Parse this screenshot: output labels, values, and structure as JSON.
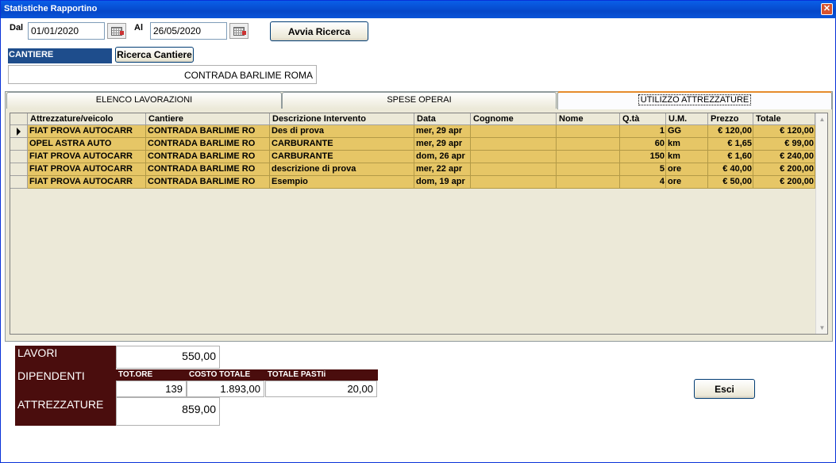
{
  "window": {
    "title": "Statistiche Rapportino",
    "close_glyph": "✕"
  },
  "filters": {
    "dal_label": "Dal",
    "dal_value": "01/01/2020",
    "al_label": "Al",
    "al_value": "26/05/2020",
    "search_button": "Avvia Ricerca"
  },
  "cantiere": {
    "label": "CANTIERE",
    "search_button": "Ricerca Cantiere",
    "value": "CONTRADA BARLIME ROMA"
  },
  "tabs": [
    {
      "label": "ELENCO LAVORAZIONI",
      "active": false
    },
    {
      "label": "SPESE OPERAI",
      "active": false
    },
    {
      "label": "UTILIZZO ATTREZZATURE",
      "active": true
    }
  ],
  "grid": {
    "columns": [
      "Attrezzature/veicolo",
      "Cantiere",
      "Descrizione Intervento",
      "Data",
      "Cognome",
      "Nome",
      "Q.tà",
      "U.M.",
      "Prezzo",
      "Totale"
    ],
    "rows": [
      [
        "FIAT PROVA AUTOCARR",
        "CONTRADA BARLIME RO",
        "Des di prova",
        "mer, 29 apr",
        "",
        "",
        "1",
        "GG",
        "€ 120,00",
        "€ 120,00"
      ],
      [
        "OPEL ASTRA AUTO",
        "CONTRADA BARLIME RO",
        "CARBURANTE",
        "mer, 29 apr",
        "",
        "",
        "60",
        "km",
        "€ 1,65",
        "€ 99,00"
      ],
      [
        "FIAT PROVA AUTOCARR",
        "CONTRADA BARLIME RO",
        "CARBURANTE",
        "dom, 26 apr",
        "",
        "",
        "150",
        "km",
        "€ 1,60",
        "€ 240,00"
      ],
      [
        "FIAT PROVA AUTOCARR",
        "CONTRADA BARLIME RO",
        "descrizione di prova",
        "mer, 22 apr",
        "",
        "",
        "5",
        "ore",
        "€ 40,00",
        "€ 200,00"
      ],
      [
        "FIAT PROVA AUTOCARR",
        "CONTRADA BARLIME RO",
        "Esempio",
        "dom, 19 apr",
        "",
        "",
        "4",
        "ore",
        "€ 50,00",
        "€ 200,00"
      ]
    ],
    "row_colors": {
      "row_bg": "#e6c666",
      "header_bg": "#ece9d8"
    }
  },
  "summary": {
    "lavori_label": "LAVORI",
    "lavori_value": "550,00",
    "dipendenti_label": "DIPENDENTI",
    "dip_headers": [
      "TOT.ORE",
      "COSTO TOTALE",
      "TOTALE PASTIi"
    ],
    "dip_values": [
      "139",
      "1.893,00",
      "20,00"
    ],
    "attrezzature_label": "ATTREZZATURE",
    "attrezzature_value": "859,00"
  },
  "exit_button": "Esci",
  "colors": {
    "title_bar": "#0a54d8",
    "label_dark": "#4a0d0d",
    "cantiere_label": "#1e4d8c"
  }
}
